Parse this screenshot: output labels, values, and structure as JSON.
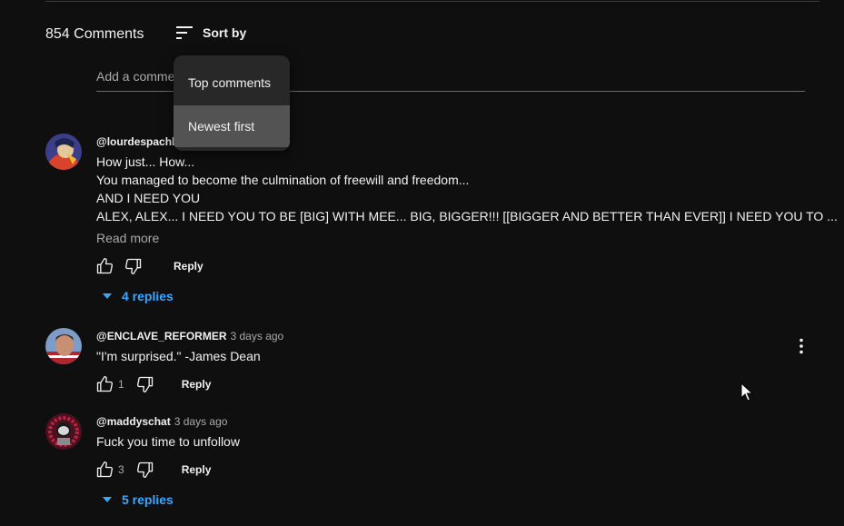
{
  "comments_header": {
    "count_text": "854 Comments",
    "sort_label": "Sort by",
    "add_placeholder": "Add a comment..."
  },
  "sort_menu": {
    "items": [
      "Top comments",
      "Newest first"
    ],
    "selected": "Newest first"
  },
  "comments": [
    {
      "author": "@lourdespachl",
      "time": "",
      "lines": [
        "How just... How...",
        "You managed to become the culmination of freewill and freedom...",
        "AND I NEED YOU",
        "ALEX, ALEX... I NEED YOU TO BE [BIG] WITH MEE... BIG, BIGGER!!! [[BIGGER AND BETTER THAN EVER]] I NEED YOU TO ..."
      ],
      "read_more": "Read more",
      "likes": "",
      "reply_label": "Reply",
      "replies_label": "4 replies"
    },
    {
      "author": "@ENCLAVE_REFORMER",
      "time": "3 days ago",
      "lines": [
        "\"I'm surprised.\" -James Dean"
      ],
      "likes": "1",
      "reply_label": "Reply"
    },
    {
      "author": "@maddyschat",
      "time": "3 days ago",
      "lines": [
        "Fuck you time to unfollow"
      ],
      "likes": "3",
      "reply_label": "Reply",
      "replies_label": "5 replies"
    }
  ],
  "colors": {
    "background": "#0f0f0f",
    "link_blue": "#3ea6ff",
    "menu_bg": "#282828",
    "menu_selected": "#535353"
  }
}
